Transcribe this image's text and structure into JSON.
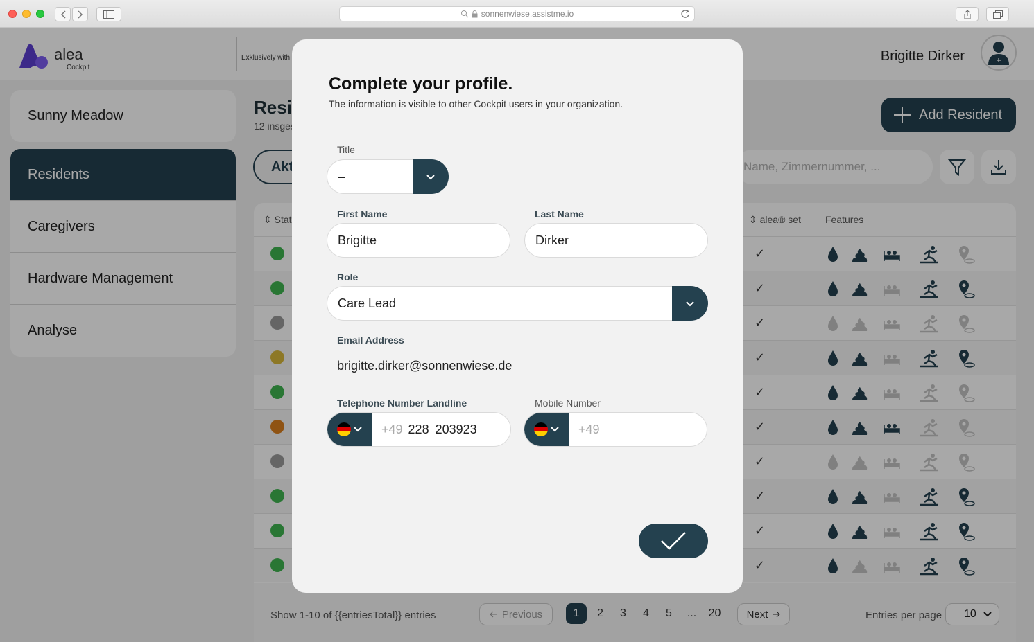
{
  "browser": {
    "url": "sonnenwiese.assistme.io"
  },
  "header": {
    "logo_text": "alea",
    "logo_sub": "Cockpit",
    "exclusive": "Exklusively with",
    "user_name": "Brigitte Dirker"
  },
  "sidebar": {
    "facility": "Sunny Meadow",
    "items": [
      {
        "label": "Residents",
        "active": true
      },
      {
        "label": "Caregivers"
      },
      {
        "label": "Hardware Management"
      },
      {
        "label": "Analyse"
      }
    ]
  },
  "main": {
    "title": "Resic",
    "subtitle": "12 insges",
    "add_button": "Add Resident",
    "tab_label": "Akt",
    "search_placeholder": "Name, Zimmernummer, ..."
  },
  "table": {
    "headers": {
      "status": "Statu",
      "set": "alea® set",
      "features": "Features"
    },
    "rows": [
      {
        "status_color": "#3fb34f",
        "check": "✓",
        "feat": [
          1,
          1,
          1,
          1,
          0
        ]
      },
      {
        "status_color": "#3fb34f",
        "check": "✓",
        "feat": [
          1,
          1,
          0,
          1,
          1
        ]
      },
      {
        "status_color": "#9a9a9a",
        "check": "✓",
        "feat": [
          0,
          0,
          0,
          0,
          0
        ]
      },
      {
        "status_color": "#d7b63a",
        "check": "✓",
        "feat": [
          1,
          1,
          0,
          1,
          1
        ]
      },
      {
        "status_color": "#3fb34f",
        "check": "✓",
        "feat": [
          1,
          1,
          0,
          0,
          0
        ]
      },
      {
        "status_color": "#d97f1e",
        "check": "✓",
        "feat": [
          1,
          1,
          1,
          0,
          0
        ]
      },
      {
        "status_color": "#9a9a9a",
        "check": "✓",
        "feat": [
          0,
          0,
          0,
          0,
          0
        ]
      },
      {
        "status_color": "#3fb34f",
        "check": "✓",
        "feat": [
          1,
          1,
          0,
          1,
          1
        ]
      },
      {
        "status_color": "#3fb34f",
        "check": "✓",
        "feat": [
          1,
          1,
          0,
          1,
          1
        ]
      },
      {
        "status_color": "#3fb34f",
        "check": "✓",
        "feat": [
          1,
          0,
          0,
          1,
          1
        ]
      }
    ],
    "footer": {
      "show_text": "Show 1-10 of {{entriesTotal}} entries",
      "previous": "Previous",
      "pages": [
        "1",
        "2",
        "3",
        "4",
        "5",
        "...",
        "20"
      ],
      "next": "Next",
      "entries_per_page_label": "Entries per page",
      "entries_per_page_value": "10"
    }
  },
  "modal": {
    "title": "Complete your profile.",
    "subtitle": "The information is visible to other Cockpit users in your organization.",
    "title_label": "Title",
    "title_value": "–",
    "first_name_label": "First Name",
    "first_name_value": "Brigitte",
    "last_name_label": "Last Name",
    "last_name_value": "Dirker",
    "role_label": "Role",
    "role_value": "Care Lead",
    "email_label": "Email Address",
    "email_value": "brigitte.dirker@sonnenwiese.de",
    "landline_label": "Telephone Number Landline",
    "landline_code": "+49",
    "landline_number": "228  203923",
    "mobile_label": "Mobile Number",
    "mobile_code": "+49"
  },
  "colors": {
    "primary": "#24414f",
    "accent": "#6a4cd6"
  }
}
